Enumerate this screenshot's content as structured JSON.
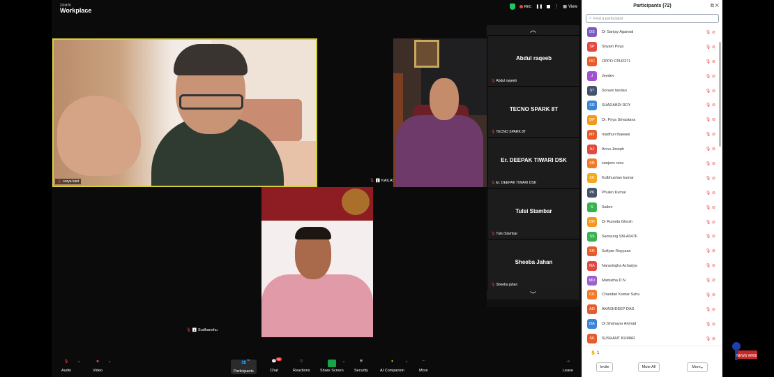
{
  "app": {
    "brand_small": "zoom",
    "brand_large": "Workplace"
  },
  "topbar": {
    "rec_label": "REC",
    "view_label": "View"
  },
  "video_tiles": {
    "tile1_name": "surya kant",
    "tile2_name": "KAILASH PRASAD YADAV",
    "tile3_name": "Sudhanshu"
  },
  "gallery": [
    {
      "big": "Abdul raqeeb",
      "small": "Abdul raqeeb"
    },
    {
      "big": "TECNO SPARK 8T",
      "small": "TECNO SPARK 8T"
    },
    {
      "big": "Er. DEEPAK TIWARI DSK",
      "small": "Er. DEEPAK TIWARI DSK"
    },
    {
      "big": "Tulsi Stambar",
      "small": "Tulsi Stambar"
    },
    {
      "big": "Sheeba Jahan",
      "small": "Sheeba jahan"
    }
  ],
  "toolbar": {
    "audio": "Audio",
    "video": "Video",
    "participants": "Participants",
    "participants_count": "72",
    "chat": "Chat",
    "chat_badge": "29",
    "reactions": "Reactions",
    "share_screen": "Share Screen",
    "security": "Security",
    "ai_companion": "AI Companion",
    "more": "More",
    "leave": "Leave"
  },
  "panel": {
    "title": "Participants (72)",
    "search_placeholder": "Find a participant",
    "raise_count": "1",
    "invite": "Invite",
    "mute_all": "Mute All",
    "more": "More",
    "participants": [
      {
        "initials": "DS",
        "name": "Dr Sanjay Agarwal",
        "color": "#7c5cc4"
      },
      {
        "initials": "SP",
        "name": "Shyam Priya",
        "color": "#e2493f"
      },
      {
        "initials": "OC",
        "name": "OPPO CPH2371",
        "color": "#e55d2d"
      },
      {
        "initials": "J",
        "name": "Jeedev",
        "color": "#a24fd1"
      },
      {
        "initials": "ST",
        "name": "Sonam tandan",
        "color": "#44526a"
      },
      {
        "initials": "SR",
        "name": "SHADABDI ROY",
        "color": "#3a86d6"
      },
      {
        "initials": "DP",
        "name": "Dr. Priya Srivastava",
        "color": "#f39a1e"
      },
      {
        "initials": "MT",
        "name": "madhuri thawani",
        "color": "#e55d2d"
      },
      {
        "initials": "AJ",
        "name": "Annu Joseph",
        "color": "#e2493f"
      },
      {
        "initials": "SR",
        "name": "sanjeev renu",
        "color": "#f07a2a"
      },
      {
        "initials": "KK",
        "name": "Kulbhushan kumar",
        "color": "#f3a81e"
      },
      {
        "initials": "PK",
        "name": "Phulen Kumar",
        "color": "#44526a"
      },
      {
        "initials": "S",
        "name": "Saikre",
        "color": "#37b24d"
      },
      {
        "initials": "DR",
        "name": "Dr Rumela Ghosh",
        "color": "#f39a1e"
      },
      {
        "initials": "SS",
        "name": "Samsung SM-A047F",
        "color": "#37b24d"
      },
      {
        "initials": "SR",
        "name": "Sufiyan Rayyaan",
        "color": "#e55d2d"
      },
      {
        "initials": "NA",
        "name": "Narasingha Acharjya",
        "color": "#e2493f"
      },
      {
        "initials": "MD",
        "name": "Mamatha D N",
        "color": "#9b5fd0"
      },
      {
        "initials": "CK",
        "name": "Chandan Kumar Sahu",
        "color": "#f07a2a"
      },
      {
        "initials": "AD",
        "name": "AKASHDEEP DAS",
        "color": "#e55d2d"
      },
      {
        "initials": "DA",
        "name": "Dr.Shahayar Ahmad",
        "color": "#3a86d6"
      },
      {
        "initials": "SK",
        "name": "SUSHANT KUMAR",
        "color": "#e55d2d"
      }
    ]
  },
  "logo": {
    "text": "NEWS WRIE"
  }
}
